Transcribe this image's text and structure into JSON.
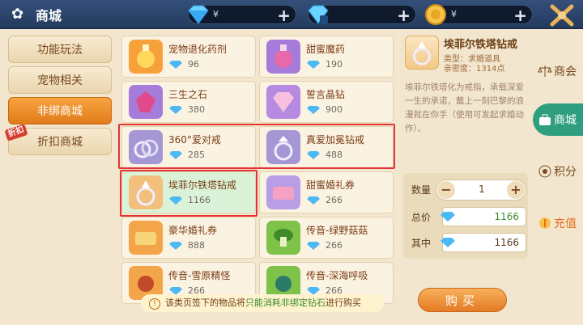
{
  "header": {
    "title": "商城",
    "diamond_amount": "¥",
    "gem_amount": "",
    "gold_amount": "¥"
  },
  "nav": [
    {
      "label": "功能玩法"
    },
    {
      "label": "宠物相关"
    },
    {
      "label": "非绑商城"
    },
    {
      "label": "折扣商城",
      "badge": "折扣"
    }
  ],
  "items": [
    {
      "name": "宠物退化药剂",
      "price": "96"
    },
    {
      "name": "甜蜜魔药",
      "price": "190"
    },
    {
      "name": "三生之石",
      "price": "380"
    },
    {
      "name": "誓言晶钻",
      "price": "900"
    },
    {
      "name": "360°爱对戒",
      "price": "285"
    },
    {
      "name": "真爱加冕钻戒",
      "price": "488"
    },
    {
      "name": "埃菲尔铁塔钻戒",
      "price": "1166"
    },
    {
      "name": "甜蜜婚礼券",
      "price": "266"
    },
    {
      "name": "豪华婚礼券",
      "price": "888"
    },
    {
      "name": "传音-绿野菇菇",
      "price": "266"
    },
    {
      "name": "传音-雪原精怪",
      "price": "266"
    },
    {
      "name": "传音-深海呼吸",
      "price": "266"
    }
  ],
  "notice": {
    "pre": "该类页签下的物品将",
    "green": "只能消耗非绑定钻石",
    "post": "进行购买"
  },
  "detail": {
    "name": "埃菲尔铁塔钻戒",
    "type": "类型：求婚道具",
    "love": "亲密度：1314点",
    "desc": "埃菲尔铁塔化为戒指，承载深爱一生的承诺，戴上一刻巴黎的浪漫就在你手（使用可发起求婚动作）。",
    "qty_label": "数量",
    "qty": "1",
    "total_label": "总价",
    "total": "1166",
    "of_label": "其中",
    "of_value": "1166",
    "buy_label": "购买"
  },
  "right_tabs": [
    {
      "label": "商会"
    },
    {
      "label": "商城"
    },
    {
      "label": "积分"
    },
    {
      "label": "充值"
    }
  ],
  "colors": {
    "accent": "#e07b1a",
    "selected_tab": "#2e9e7e",
    "highlight": "#e33434"
  }
}
